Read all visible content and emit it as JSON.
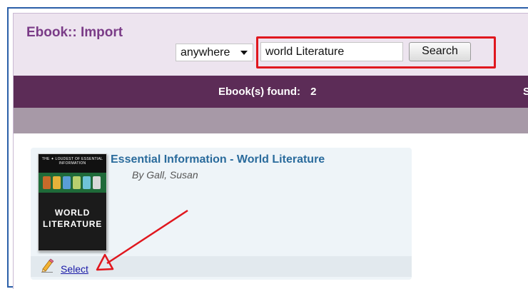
{
  "app": {
    "title": "Ebook:: Import"
  },
  "search": {
    "scope_value": "anywhere",
    "query_value": "world Literature",
    "button_label": "Search"
  },
  "results": {
    "found_label": "Ebook(s) found:",
    "found_count": "2",
    "bar_partial_text": "S"
  },
  "book": {
    "title": "Essential Information - World Literature",
    "author": "By Gall, Susan",
    "cover_series": "THE ✦ LOUDEST OF ESSENTIAL INFORMATION",
    "cover_title_line1": "WORLD",
    "cover_title_line2": "LITERATURE",
    "select_label": "Select"
  },
  "annotations": {
    "highlight_color": "#e0171e",
    "arrow_color": "#e0171e"
  },
  "colors": {
    "header_bg": "#ede4ef",
    "title_purple": "#7a3b87",
    "results_bar": "#5c2c57",
    "band": "#a799a7",
    "link_blue": "#2a6b9c"
  },
  "icons": [
    "caret-down-icon",
    "pencil-icon",
    "red-arrow-annotation"
  ]
}
